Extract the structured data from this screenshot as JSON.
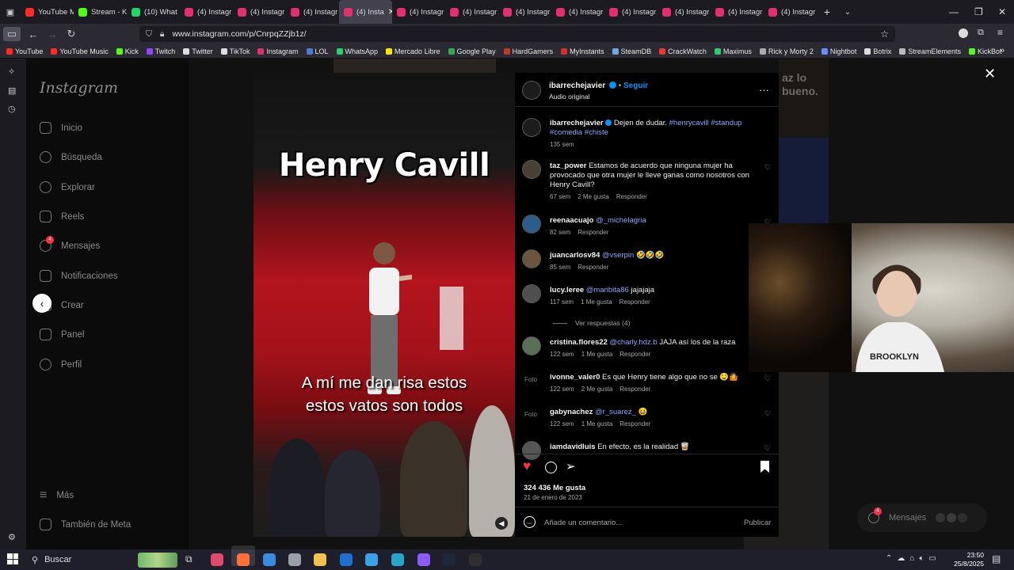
{
  "browser": {
    "tabs": [
      {
        "label": "YouTube M",
        "color": "#ff2a2a"
      },
      {
        "label": "Stream - K",
        "color": "#53fc18"
      },
      {
        "label": "(10) What",
        "color": "#25d366"
      },
      {
        "label": "(4) Instagr",
        "color": "#e1306c"
      },
      {
        "label": "(4) Instagr",
        "color": "#e1306c"
      },
      {
        "label": "(4) Instagr",
        "color": "#e1306c"
      },
      {
        "label": "(4) Insta",
        "color": "#e1306c"
      },
      {
        "label": "(4) Instagr",
        "color": "#e1306c"
      },
      {
        "label": "(4) Instagr",
        "color": "#e1306c"
      },
      {
        "label": "(4) Instagr",
        "color": "#e1306c"
      },
      {
        "label": "(4) Instagr",
        "color": "#e1306c"
      },
      {
        "label": "(4) Instagr",
        "color": "#e1306c"
      },
      {
        "label": "(4) Instagr",
        "color": "#e1306c"
      },
      {
        "label": "(4) Instagr",
        "color": "#e1306c"
      },
      {
        "label": "(4) Instagr",
        "color": "#e1306c"
      }
    ],
    "active_tab_index": 6,
    "url": "www.instagram.com/p/CnrpqZZjb1z/",
    "bookmarks": [
      {
        "label": "YouTube",
        "color": "#ff2a2a"
      },
      {
        "label": "YouTube Music",
        "color": "#ff2a2a"
      },
      {
        "label": "Kick",
        "color": "#53fc18"
      },
      {
        "label": "Twitch",
        "color": "#9146ff"
      },
      {
        "label": "Twitter",
        "color": "#dddddd"
      },
      {
        "label": "TikTok",
        "color": "#dddddd"
      },
      {
        "label": "Instagram",
        "color": "#e1306c"
      },
      {
        "label": "LOL",
        "color": "#4b7bd6"
      },
      {
        "label": "WhatsApp",
        "color": "#25d366"
      },
      {
        "label": "Mercado Libre",
        "color": "#ffe600"
      },
      {
        "label": "Google Play",
        "color": "#34a853"
      },
      {
        "label": "HardGamers",
        "color": "#c0392b"
      },
      {
        "label": "MyInstants",
        "color": "#d32f2f"
      },
      {
        "label": "SteamDB",
        "color": "#6fa8dc"
      },
      {
        "label": "CrackWatch",
        "color": "#e53935"
      },
      {
        "label": "Maximus",
        "color": "#2ecc71"
      },
      {
        "label": "Rick y Morty 2",
        "color": "#aaaaaa"
      },
      {
        "label": "Nightbot",
        "color": "#6b8cff"
      },
      {
        "label": "Botrix",
        "color": "#dddddd"
      },
      {
        "label": "StreamElements",
        "color": "#bbbbbb"
      },
      {
        "label": "KickBot",
        "color": "#53fc18"
      }
    ]
  },
  "instagram": {
    "logo": "Instagram",
    "nav": [
      {
        "label": "Inicio",
        "icon": "home-icon"
      },
      {
        "label": "Búsqueda",
        "icon": "search-icon"
      },
      {
        "label": "Explorar",
        "icon": "compass-icon"
      },
      {
        "label": "Reels",
        "icon": "reels-icon"
      },
      {
        "label": "Mensajes",
        "icon": "messenger-icon",
        "badge": "4"
      },
      {
        "label": "Notificaciones",
        "icon": "heart-icon"
      },
      {
        "label": "Crear",
        "icon": "plus-icon"
      },
      {
        "label": "Panel",
        "icon": "panel-icon"
      },
      {
        "label": "Perfil",
        "icon": "profile-icon"
      }
    ],
    "more": "Más",
    "meta": "También de Meta",
    "backdrop_text": "az lo\nbueno."
  },
  "video": {
    "title": "Henry Cavill",
    "subtitle_line1": "A mí me dan risa estos",
    "subtitle_line2": "estos vatos son todos"
  },
  "post": {
    "author": "ibarrechejavier",
    "follow": "Seguir",
    "audio": "Audio original",
    "caption_user": "ibarrechejavier",
    "caption_text": "Dejen de dudar.",
    "caption_tags_1": "#henrycavill #standup",
    "caption_tags_2": "#comedia #chiste",
    "caption_time": "135 sem",
    "comments": [
      {
        "user": "taz_power",
        "text": "Estamos de acuerdo que ninguna mujer ha provocado que otra mujer le lleve ganas como nosotros con Henry Cavill?",
        "time": "67 sem",
        "likes": "2 Me gusta",
        "reply": "Responder"
      },
      {
        "user": "reenaacuajo",
        "mention": "@_michelagria",
        "text": "",
        "time": "82 sem",
        "likes": "",
        "reply": "Responder"
      },
      {
        "user": "juancarlosv84",
        "mention": "@vserpin",
        "text": "🤣🤣🤣",
        "time": "85 sem",
        "likes": "",
        "reply": "Responder"
      },
      {
        "user": "lucy.leree",
        "mention": "@maribita86",
        "text": "jajajaja",
        "time": "117 sem",
        "likes": "1 Me gusta",
        "reply": "Responder"
      },
      {
        "user": "cristina.flores22",
        "mention": "@charly.hdz.b",
        "text": "JAJA así los de la raza",
        "time": "122 sem",
        "likes": "1 Me gusta",
        "reply": "Responder"
      },
      {
        "user": "ivonne_valer0",
        "mention": "",
        "text": "Es que Henry tiene algo que no se 🤤🤷",
        "time": "122 sem",
        "likes": "2 Me gusta",
        "reply": "Responder"
      },
      {
        "user": "gabynachez",
        "mention": "@r_suarez_",
        "text": "😆",
        "time": "122 sem",
        "likes": "1 Me gusta",
        "reply": "Responder"
      },
      {
        "user": "iamdavidluis",
        "mention": "",
        "text": "En efecto, es la realidad 🥃",
        "time": "",
        "likes": "",
        "reply": ""
      }
    ],
    "view_replies": "Ver respuestas (4)",
    "photo_placeholder": "Foto",
    "likes": "324 436 Me gusta",
    "date": "21 de enero de 2023",
    "add_comment_placeholder": "Añade un comentario...",
    "publish": "Publicar",
    "accent": "#0095f6",
    "like_color": "#ff3040"
  },
  "messages_pill": {
    "label": "Mensajes",
    "badge": "4"
  },
  "taskbar": {
    "search": "Buscar",
    "time": "23:50",
    "date": "25/8/2025"
  }
}
